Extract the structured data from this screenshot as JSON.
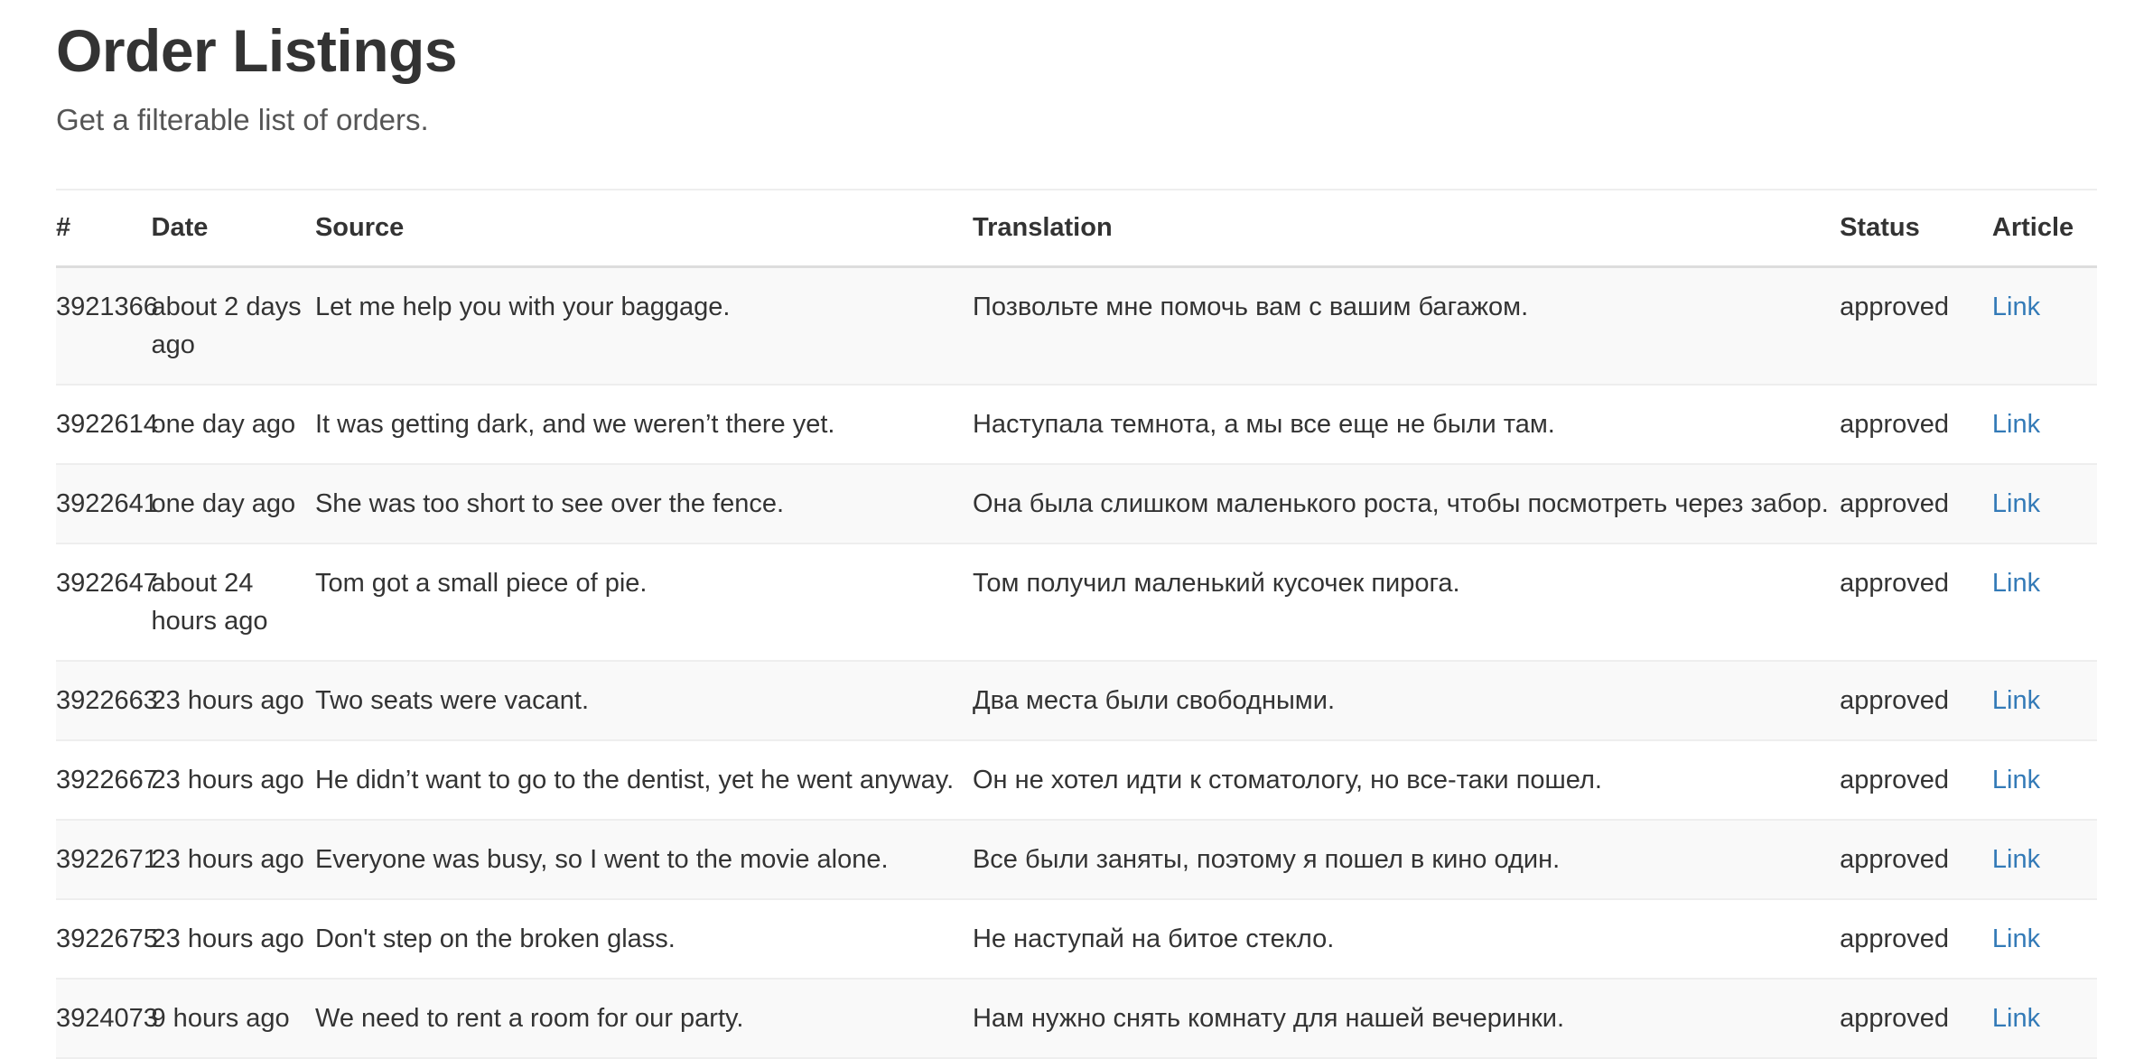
{
  "header": {
    "title": "Order Listings",
    "subtitle": "Get a filterable list of orders."
  },
  "colors": {
    "link": "#337ab7",
    "text": "#333333",
    "subtitle": "#555555",
    "row_stripe": "#f9f9f9",
    "border": "#dddddd"
  },
  "table": {
    "columns": [
      {
        "key": "id",
        "label": "#"
      },
      {
        "key": "date",
        "label": "Date"
      },
      {
        "key": "source",
        "label": "Source"
      },
      {
        "key": "translation",
        "label": "Translation"
      },
      {
        "key": "status",
        "label": "Status"
      },
      {
        "key": "article",
        "label": "Article"
      }
    ],
    "rows": [
      {
        "id": "3921366",
        "date": "about 2 days ago",
        "source": "Let me help you with your baggage.",
        "translation": "Позвольте мне помочь вам с вашим багажом.",
        "status": "approved",
        "article": "Link"
      },
      {
        "id": "3922614",
        "date": "one day ago",
        "source": "It was getting dark, and we weren’t there yet.",
        "translation": "Наступала темнота, а мы все еще не были там.",
        "status": "approved",
        "article": "Link"
      },
      {
        "id": "3922641",
        "date": "one day ago",
        "source": "She was too short to see over the fence.",
        "translation": "Она была слишком маленького роста, чтобы посмотреть через забор.",
        "status": "approved",
        "article": "Link"
      },
      {
        "id": "3922647",
        "date": "about 24 hours ago",
        "source": "Tom got a small piece of pie.",
        "translation": "Том получил маленький кусочек пирога.",
        "status": "approved",
        "article": "Link"
      },
      {
        "id": "3922663",
        "date": "23 hours ago",
        "source": "Two seats were vacant.",
        "translation": "Два места были свободными.",
        "status": "approved",
        "article": "Link"
      },
      {
        "id": "3922667",
        "date": "23 hours ago",
        "source": "He didn’t want to go to the dentist, yet he went anyway.",
        "translation": "Он не хотел идти к стоматологу, но все-таки пошел.",
        "status": "approved",
        "article": "Link"
      },
      {
        "id": "3922671",
        "date": "23 hours ago",
        "source": "Everyone was busy, so I went to the movie alone.",
        "translation": "Все были заняты, поэтому я пошел в кино один.",
        "status": "approved",
        "article": "Link"
      },
      {
        "id": "3922675",
        "date": "23 hours ago",
        "source": "Don't step on the broken glass.",
        "translation": "Не наступай на битое стекло.",
        "status": "approved",
        "article": "Link"
      },
      {
        "id": "3924073",
        "date": "9 hours ago",
        "source": "We need to rent a room for our party.",
        "translation": "Нам нужно снять комнату для нашей вечеринки.",
        "status": "approved",
        "article": "Link"
      }
    ]
  }
}
